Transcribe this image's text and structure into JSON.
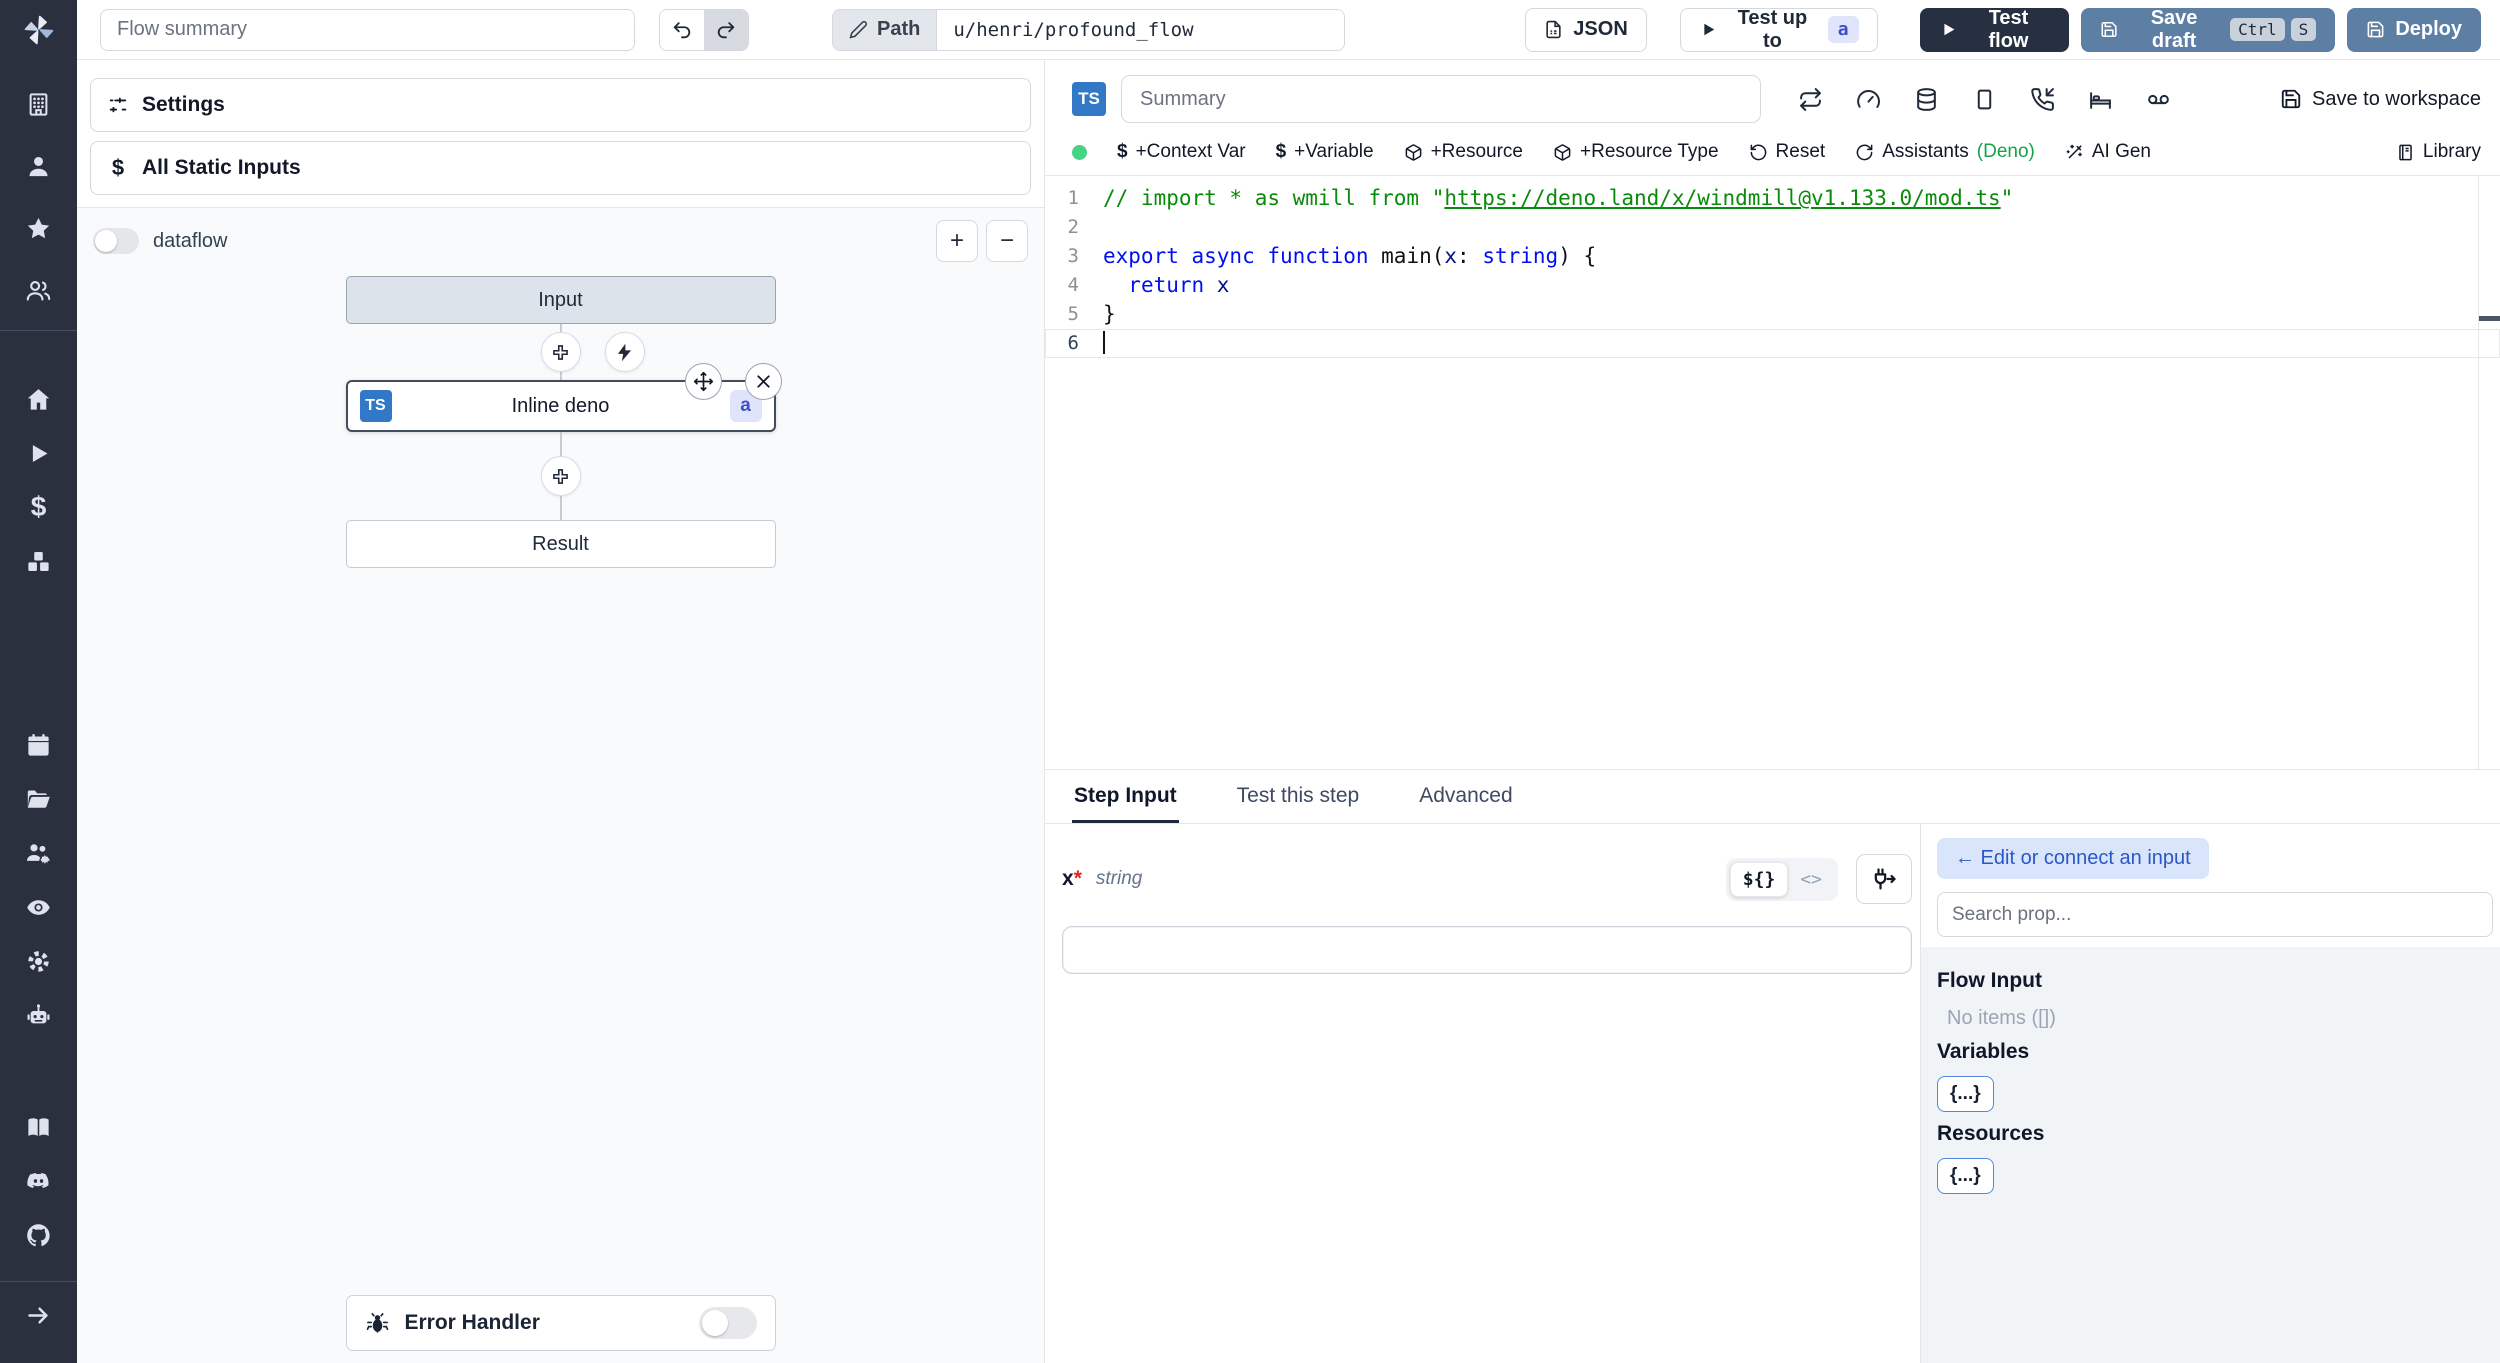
{
  "topbar": {
    "flow_summary_placeholder": "Flow summary",
    "path_label": "Path",
    "path_value": "u/henri/profound_flow",
    "json_button": "JSON",
    "test_up_to_label": "Test up to",
    "test_up_to_badge": "a",
    "test_flow_label": "Test flow",
    "save_draft_label": "Save draft",
    "save_draft_kbd": [
      "Ctrl",
      "S"
    ],
    "deploy_label": "Deploy"
  },
  "sidebar": {
    "icon_names": [
      "building",
      "person",
      "star",
      "people",
      "home",
      "play",
      "dollar",
      "cubes",
      "calendar",
      "folder-open",
      "people-gear",
      "eye",
      "gear",
      "robot",
      "book",
      "discord",
      "github",
      "arrow-right"
    ]
  },
  "flow_panel": {
    "settings_label": "Settings",
    "static_inputs_label": "All Static Inputs",
    "dataflow_label": "dataflow",
    "nodes": {
      "input": "Input",
      "step_title": "Inline deno",
      "step_lang_badge": "TS",
      "step_id_badge": "a",
      "result": "Result"
    },
    "error_handler_label": "Error Handler"
  },
  "editor": {
    "lang_badge": "TS",
    "summary_placeholder": "Summary",
    "save_to_workspace": "Save to workspace",
    "toolbar": {
      "context_var": "+Context Var",
      "variable": "+Variable",
      "resource": "+Resource",
      "resource_type": "+Resource Type",
      "reset": "Reset",
      "assistants": "Assistants",
      "assistants_lang": "(Deno)",
      "ai_gen": "AI Gen",
      "library": "Library"
    },
    "code": {
      "line_numbers": [
        "1",
        "2",
        "3",
        "4",
        "5",
        "6"
      ],
      "l1_pre": "// import * as wmill from \"",
      "l1_url": "https://deno.land/x/windmill@v1.133.0/mod.ts",
      "l1_post": "\"",
      "l3_kw": "export async function ",
      "l3_fn": "main",
      "l3_p1": "(",
      "l3_var": "x",
      "l3_colon": ": ",
      "l3_type": "string",
      "l3_p2": ") {",
      "l4_indent": "  ",
      "l4_kw": "return",
      "l4_var": " x",
      "l5": "}"
    }
  },
  "bottom": {
    "tabs": [
      {
        "label": "Step Input"
      },
      {
        "label": "Test this step"
      },
      {
        "label": "Advanced"
      }
    ],
    "arg_name": "x",
    "required_mark": "*",
    "arg_type": "string",
    "expr_toggle": "${}",
    "code_toggle": "<>",
    "prop_panel": {
      "edit_connect": "← Edit or connect an input",
      "search_placeholder": "Search prop...",
      "flow_input_title": "Flow Input",
      "no_items": "No items ([])",
      "variables_title": "Variables",
      "resources_title": "Resources",
      "object_chip": "{...}"
    }
  },
  "glyphs": {
    "plus": "+",
    "minus": "−",
    "dollar": "$"
  },
  "colors": {
    "accent_blue": "#5e7fa4",
    "dark_navy": "#263040",
    "sidebar": "#2a303e",
    "ts_blue": "#3178c6",
    "green_dot": "#44d483",
    "deno_green": "#16a34a"
  }
}
